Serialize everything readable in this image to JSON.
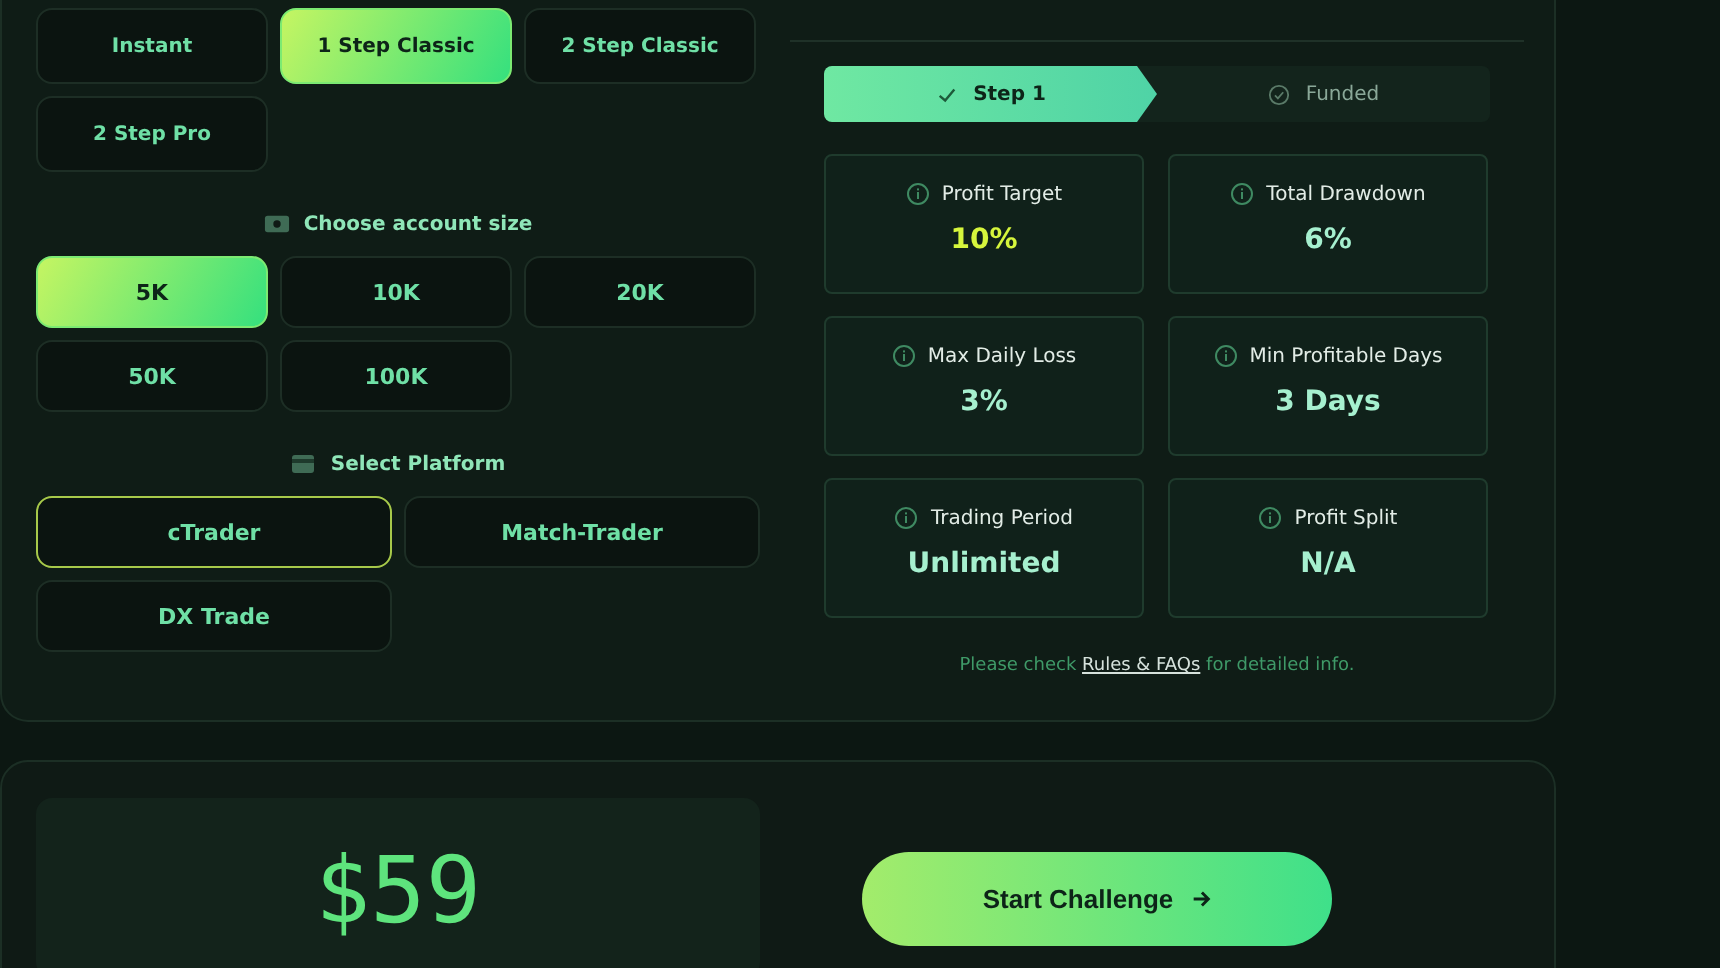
{
  "challenge_types": [
    {
      "label": "Instant",
      "selected": false
    },
    {
      "label": "1 Step Classic",
      "selected": true
    },
    {
      "label": "2 Step Classic",
      "selected": false
    },
    {
      "label": "2 Step Pro",
      "selected": false
    }
  ],
  "account_size": {
    "label": "Choose account size",
    "options": [
      {
        "label": "5K",
        "selected": true
      },
      {
        "label": "10K",
        "selected": false
      },
      {
        "label": "20K",
        "selected": false
      },
      {
        "label": "50K",
        "selected": false
      },
      {
        "label": "100K",
        "selected": false
      }
    ]
  },
  "platform": {
    "label": "Select Platform",
    "options": [
      {
        "label": "cTrader",
        "selected": true
      },
      {
        "label": "Match-Trader",
        "selected": false
      },
      {
        "label": "DX Trade",
        "selected": false
      }
    ]
  },
  "steps": [
    {
      "label": "Step 1",
      "selected": true
    },
    {
      "label": "Funded",
      "selected": false
    }
  ],
  "rules": [
    {
      "label": "Profit Target",
      "value": "10%",
      "highlighted": true
    },
    {
      "label": "Total Drawdown",
      "value": "6%",
      "highlighted": false
    },
    {
      "label": "Max Daily Loss",
      "value": "3%",
      "highlighted": false
    },
    {
      "label": "Min Profitable Days",
      "value": "3 Days",
      "highlighted": false
    },
    {
      "label": "Trading Period",
      "value": "Unlimited",
      "highlighted": false
    },
    {
      "label": "Profit Split",
      "value": "N/A",
      "highlighted": false
    }
  ],
  "note": {
    "before": "Please check",
    "link": "Rules & FAQs",
    "after": "for detailed info."
  },
  "price": "$59",
  "start_button": {
    "label": "Start Challenge"
  }
}
